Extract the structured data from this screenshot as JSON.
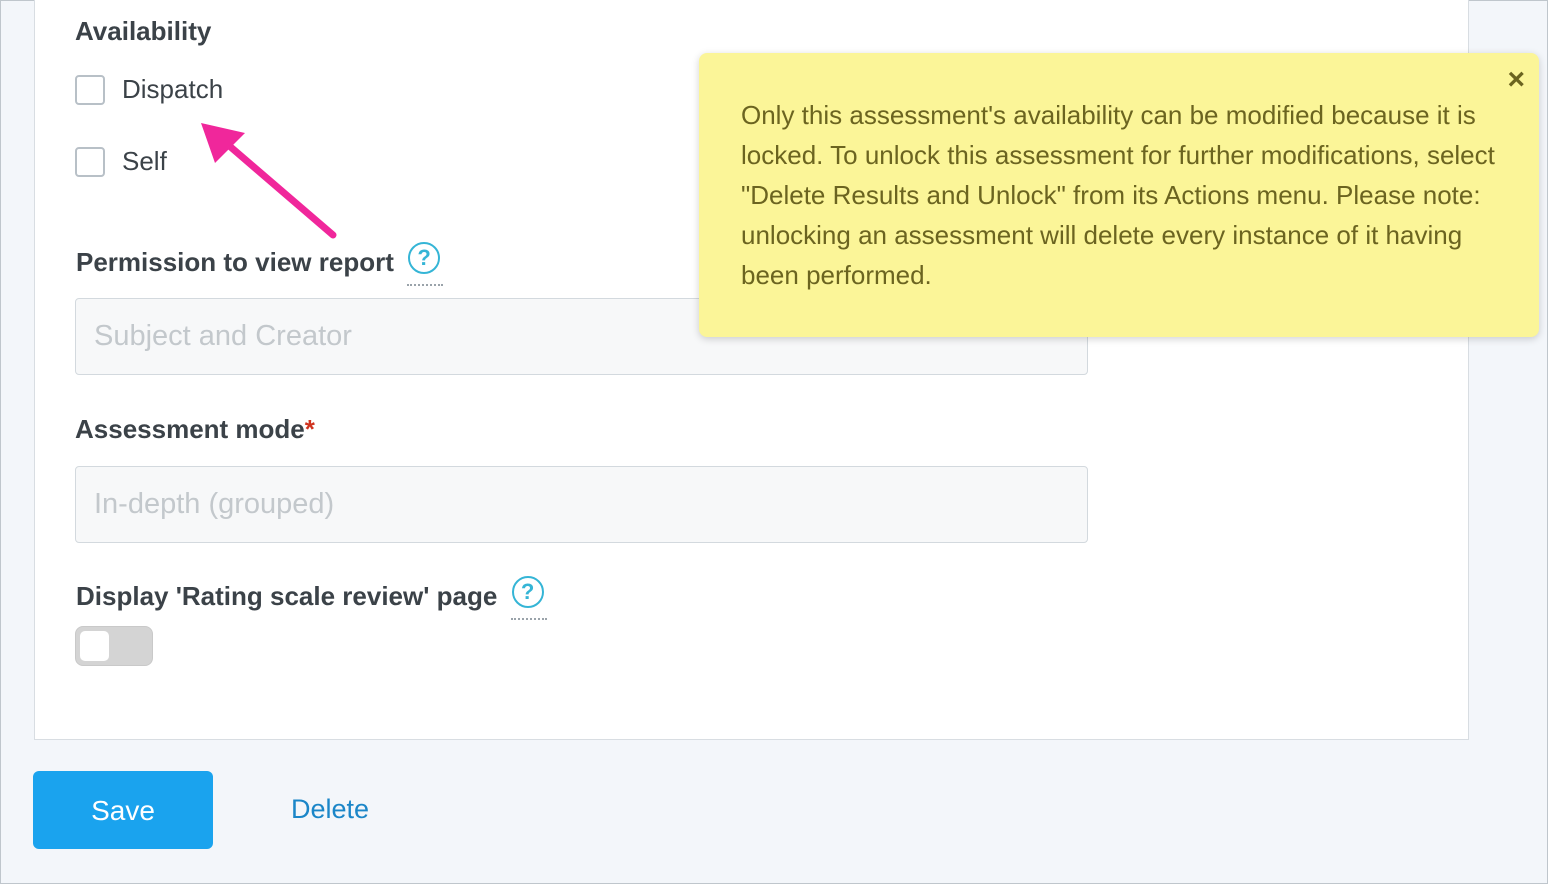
{
  "availability": {
    "label": "Availability",
    "options": [
      {
        "label": "Dispatch",
        "checked": false
      },
      {
        "label": "Self",
        "checked": false
      }
    ]
  },
  "permission": {
    "label": "Permission to view report",
    "value": "Subject and Creator",
    "help_icon": "question-circle-icon"
  },
  "assessment_mode": {
    "label": "Assessment mode",
    "required_mark": "*",
    "value": "In-depth (grouped)"
  },
  "rating_scale_review": {
    "label": "Display 'Rating scale review' page",
    "help_icon": "question-circle-icon",
    "enabled": false
  },
  "actions": {
    "save_label": "Save",
    "delete_label": "Delete"
  },
  "tooltip": {
    "text": "Only this assessment's availability can be modified because it is locked. To unlock this assessment for further modifications, select \"Delete Results and Unlock\" from its Actions menu. Please note: unlocking an assessment will delete every instance of it having been performed.",
    "close_symbol": "×"
  },
  "colors": {
    "primary": "#1aa3ee",
    "link": "#1b86c8",
    "tooltip_bg": "#fbf598",
    "annotation_arrow": "#f0279b",
    "help_icon": "#35b5d6",
    "required": "#d0331f"
  }
}
